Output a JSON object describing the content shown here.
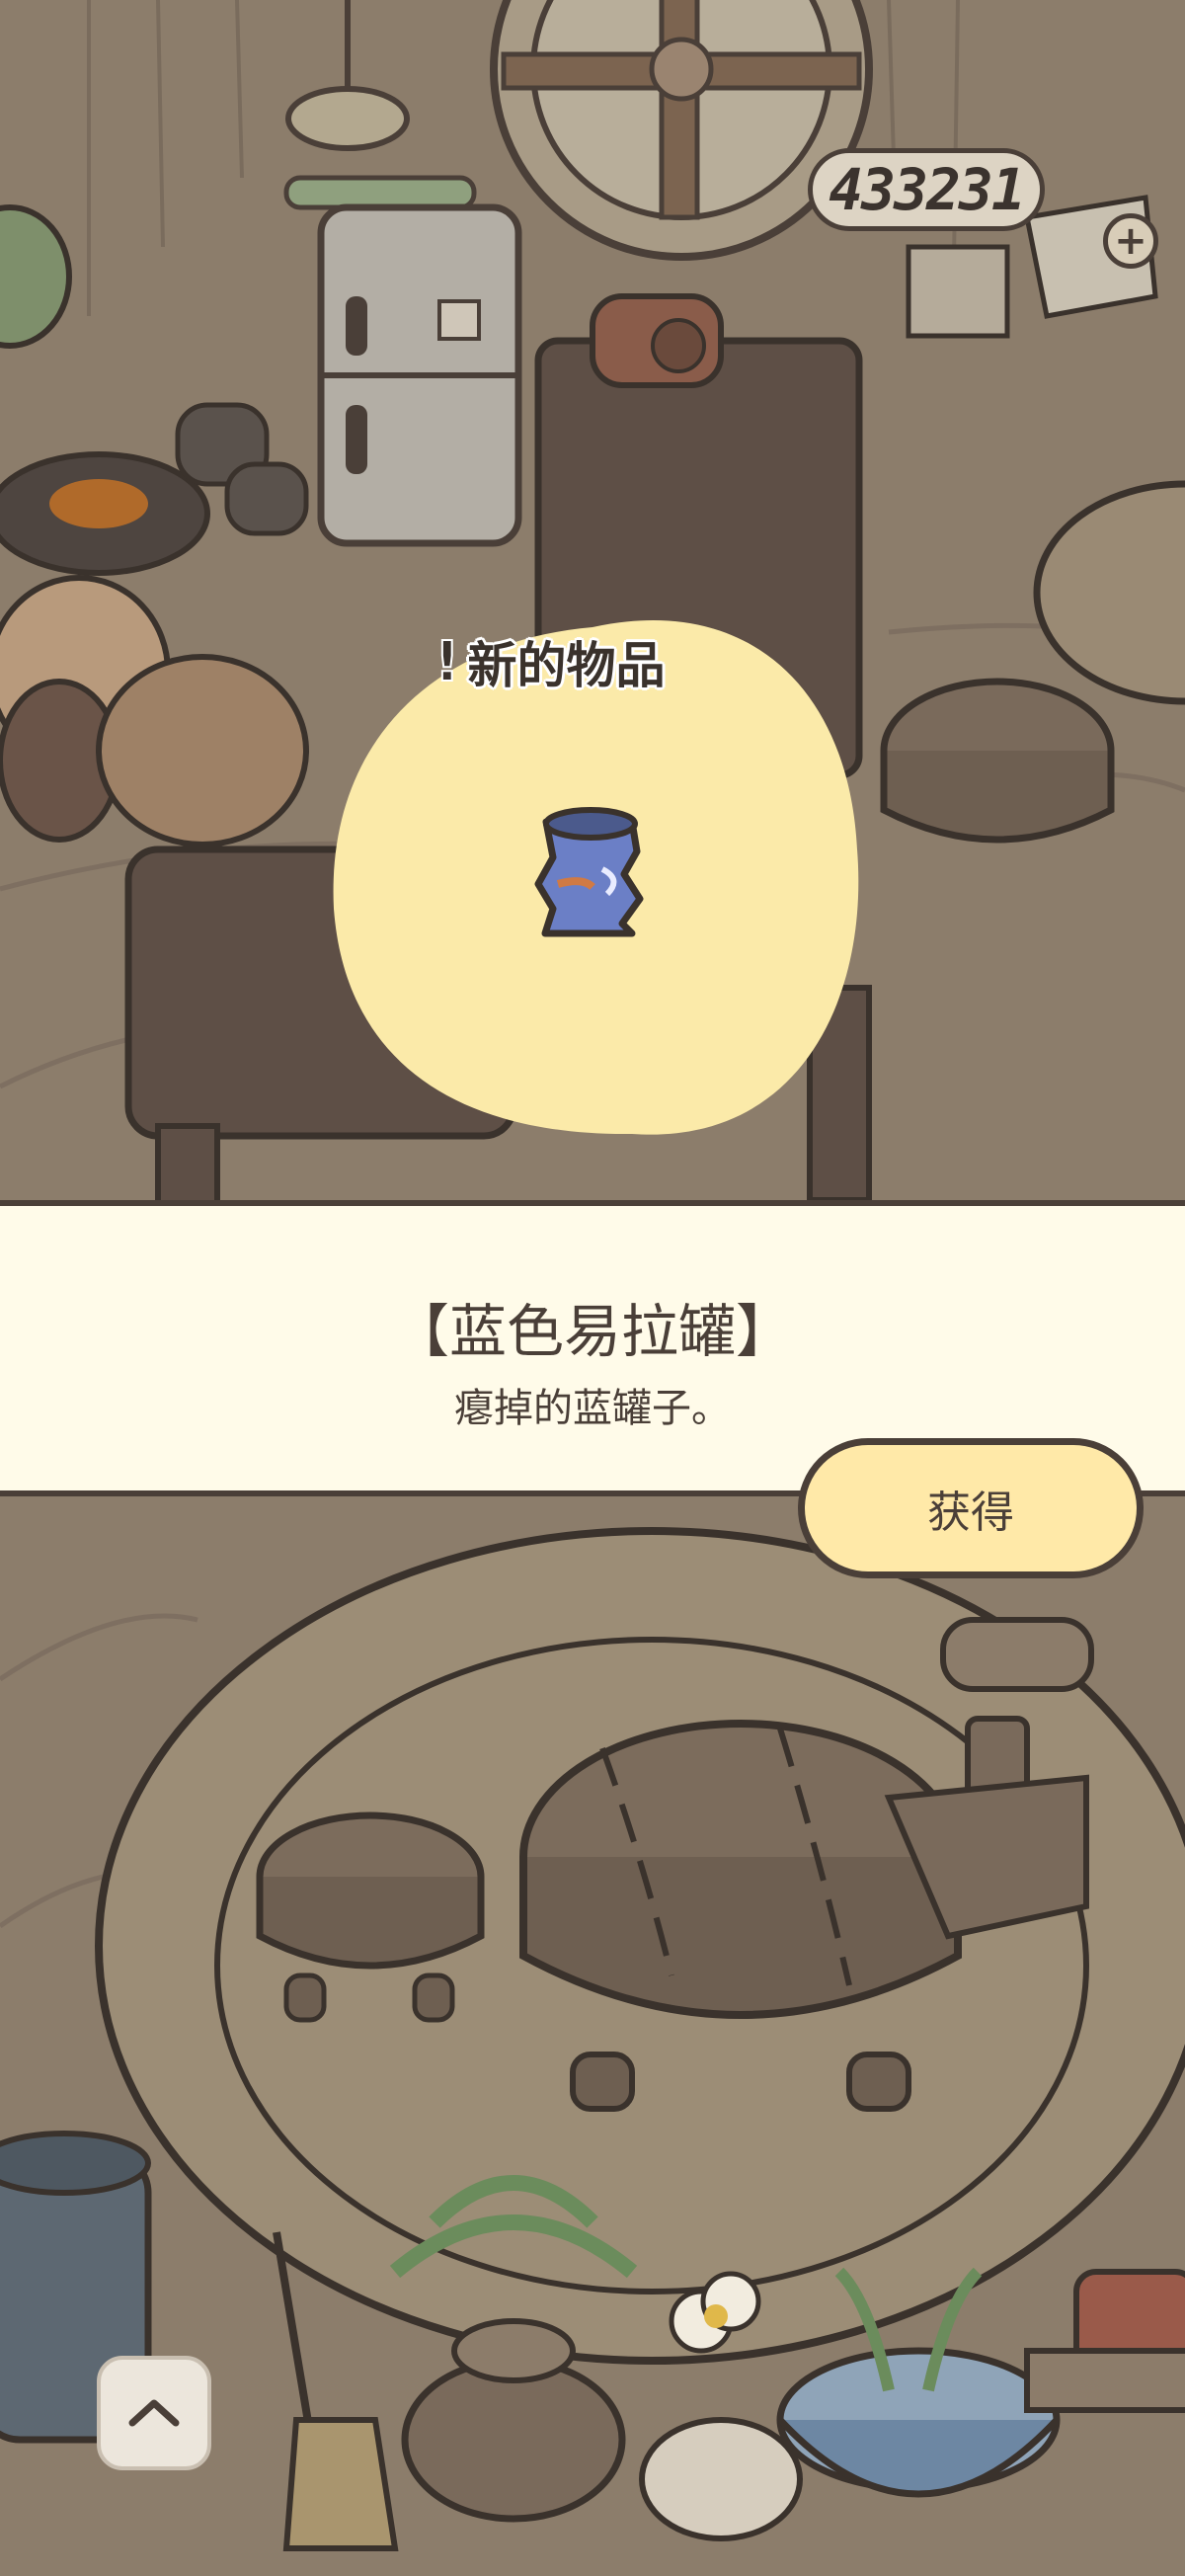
{
  "currency": {
    "amount": "433231",
    "add_symbol": "+",
    "icon": "acorn-icon"
  },
  "popup": {
    "badge_symbol": "!",
    "title": "新的物品",
    "item_icon": "blue-can-icon"
  },
  "item": {
    "name": "【蓝色易拉罐】",
    "description": "瘪掉的蓝罐子。"
  },
  "actions": {
    "get_label": "获得",
    "expand_icon": "chevron-up-icon"
  },
  "colors": {
    "outline": "#4a3f38",
    "band": "#fffbe9",
    "button": "#ffe9a8",
    "spotlight": "#fbeaa9",
    "floor": "#8a7c6b"
  }
}
